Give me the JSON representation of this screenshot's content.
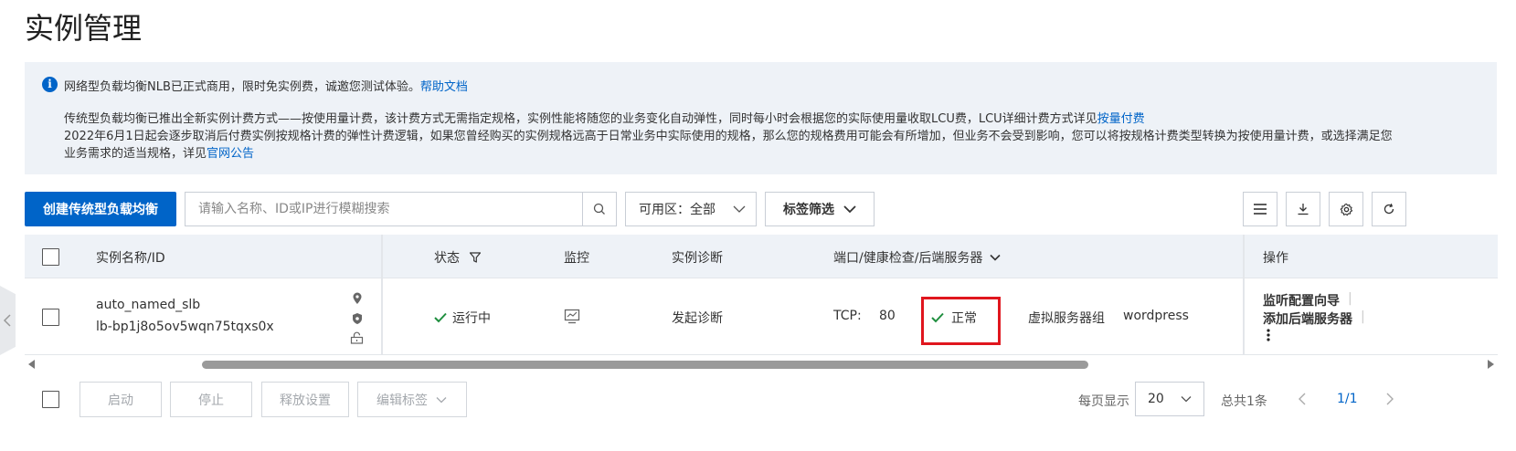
{
  "page": {
    "title": "实例管理"
  },
  "notice": {
    "line1_text": "网络型负载均衡NLB已正式商用，限时免实例费，诚邀您测试体验。",
    "line1_link": "帮助文档",
    "para_text1": "传统型负载均衡已推出全新实例计费方式——按使用量计费，该计费方式无需指定规格，实例性能将随您的业务变化自动弹性，同时每小时会根据您的实际使用量收取LCU费，LCU详细计费方式详见",
    "para_link1": "按量付费",
    "para_text2": "2022年6月1日起会逐步取消后付费实例按规格计费的弹性计费逻辑，如果您曾经购买的实例规格远高于日常业务中实际使用的规格，那么您的规格费用可能会有所增加，但业务不会受到影响，您可以将按规格计费类型转换为按使用量计费，或选择满足您业务需求的适当规格，详见",
    "para_link2": "官网公告"
  },
  "toolbar": {
    "create_label": "创建传统型负载均衡",
    "search_placeholder": "请输入名称、ID或IP进行模糊搜索",
    "zone_label": "可用区：",
    "zone_value": "全部",
    "tag_filter_label": "标签筛选"
  },
  "table": {
    "headers": {
      "name": "实例名称/ID",
      "status": "状态",
      "monitor": "监控",
      "diagnose": "实例诊断",
      "ports": "端口/健康检查/后端服务器",
      "actions": "操作"
    },
    "rows": [
      {
        "name": "auto_named_slb",
        "id": "lb-bp1j8o5ov5wqn75tqxs0x",
        "status": "运行中",
        "diagnose": "发起诊断",
        "protocol": "TCP:",
        "port": "80",
        "health": "正常",
        "server_type": "虚拟服务器组",
        "server_group": "wordpress",
        "action1": "监听配置向导",
        "action2": "添加后端服务器"
      }
    ]
  },
  "bottom": {
    "start": "启动",
    "stop": "停止",
    "release": "释放设置",
    "edit_tags": "编辑标签",
    "per_page_label": "每页显示",
    "per_page_value": "20",
    "total": "总共1条",
    "page": "1/1"
  },
  "colors": {
    "primary": "#0064c8",
    "success": "#1e8e3e",
    "highlight": "#e0161e",
    "notice_bg": "#eef2f7"
  }
}
